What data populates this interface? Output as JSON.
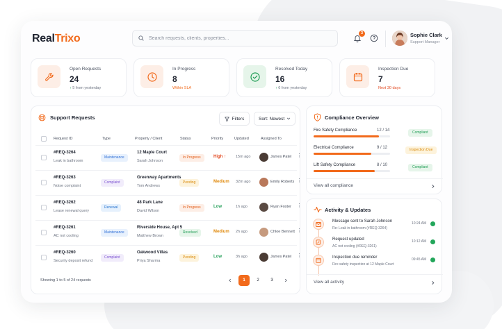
{
  "app": {
    "logo_part1": "Real",
    "logo_part2": "Trixo",
    "search_placeholder": "Search requests, clients, properties...",
    "notification_count": "3",
    "user_name": "Sophie Clark",
    "user_role": "Support Manager"
  },
  "stats": [
    {
      "label": "Open Requests",
      "value": "24",
      "sub_arrow": "↑",
      "sub": "5 from yesterday"
    },
    {
      "label": "In Progress",
      "value": "8",
      "sub": "Within SLA"
    },
    {
      "label": "Resolved Today",
      "value": "16",
      "sub_arrow": "↑",
      "sub": "6 from yesterday"
    },
    {
      "label": "Inspection Due",
      "value": "7",
      "sub": "Next 30 days"
    }
  ],
  "support": {
    "title": "Support Requests",
    "filters_label": "Filters",
    "sort_label": "Sort: Newest",
    "columns": [
      "Request ID",
      "Type",
      "Property / Client",
      "Status",
      "Priority",
      "Updated",
      "Assigned To"
    ],
    "rows": [
      {
        "id": "#REQ-3264",
        "desc": "Leak in bathroom",
        "type": "Maintenance",
        "property": "12 Maple Court",
        "client": "Sarah Johnson",
        "status": "In Progress",
        "priority": "High",
        "priority_arrow": "↑",
        "updated": "15m ago",
        "assignee": "James Patel"
      },
      {
        "id": "#REQ-3263",
        "desc": "Noise complaint",
        "type": "Complaint",
        "property": "Greenway Apartments",
        "client": "Tom Andrews",
        "status": "Pending",
        "priority": "Medium",
        "updated": "32m ago",
        "assignee": "Emily Roberts"
      },
      {
        "id": "#REQ-3262",
        "desc": "Lease renewal query",
        "type": "Renewal",
        "property": "48 Park Lane",
        "client": "David Wilson",
        "status": "In Progress",
        "priority": "Low",
        "updated": "1h ago",
        "assignee": "Ryan Foster"
      },
      {
        "id": "#REQ-3261",
        "desc": "AC not cooling",
        "type": "Maintenance",
        "property": "Riverside House, Apt 5",
        "client": "Matthew Brown",
        "status": "Resolved",
        "priority": "Medium",
        "updated": "2h ago",
        "assignee": "Chloe Bennett"
      },
      {
        "id": "#REQ-3260",
        "desc": "Security deposit refund",
        "type": "Complaint",
        "property": "Oakwood Villas",
        "client": "Priya Sharma",
        "status": "Pending",
        "priority": "Low",
        "updated": "3h ago",
        "assignee": "James Patel"
      }
    ],
    "showing": "Showing 1 to 5 of 24 requests",
    "pages": [
      "1",
      "2",
      "3"
    ]
  },
  "compliance": {
    "title": "Compliance Overview",
    "items": [
      {
        "name": "Fire Safety Compliance",
        "fraction": "12 / 14",
        "progress": 0.857,
        "badge": "Compliant"
      },
      {
        "name": "Electrical Compliance",
        "fraction": "9 / 12",
        "progress": 0.75,
        "badge": "Inspection Due"
      },
      {
        "name": "Lift Safety Compliance",
        "fraction": "8 / 10",
        "progress": 0.8,
        "badge": "Compliant"
      }
    ],
    "view_all": "View all compliance"
  },
  "activity": {
    "title": "Activity & Updates",
    "items": [
      {
        "title": "Message sent to Sarah Johnson",
        "sub": "Re: Leak in bathroom (#REQ-3264)",
        "time": "10:24 AM"
      },
      {
        "title": "Request updated",
        "sub": "AC not cooling (#REQ-3261)",
        "time": "10:12 AM"
      },
      {
        "title": "Inspection due reminder",
        "sub": "Fire safety inspection at 12 Maple Court",
        "time": "09:45 AM"
      }
    ],
    "view_all": "View all activity"
  },
  "colors": {
    "accent": "#f26a1b",
    "success": "#1f9d55",
    "warning": "#d98a0b"
  }
}
